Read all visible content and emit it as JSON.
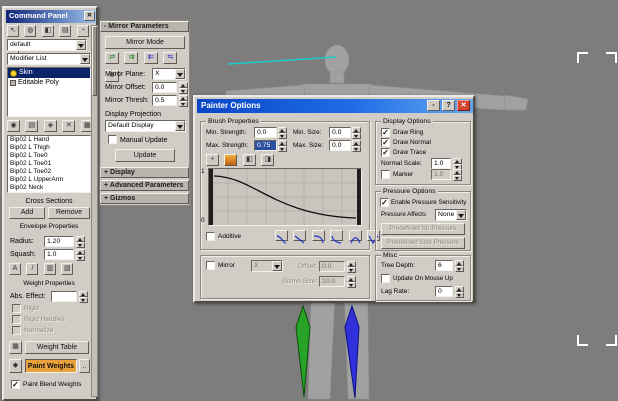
{
  "colors": {
    "viewport_bg": "#7d7d7d",
    "panel_bg": "#d1cdc6",
    "titlebar_gradient": [
      "#10277a",
      "#9cc1ec"
    ],
    "dialog_title_gradient": [
      "#0a46c6",
      "#63a7f0"
    ],
    "selection_blue": "#0a246a",
    "field_selected": "#2a50a0",
    "paint_weights_active": "#e9a13b",
    "bone_green": "#27a327",
    "bone_blue": "#3030dd",
    "crosssection_cyan": "#19cccc",
    "close_red": "#d6432f"
  },
  "icons": {
    "close": "✕",
    "help": "?",
    "minimize": "-",
    "collapse": "-",
    "expand": "+",
    "ellipsis": "..",
    "panel_tabs": [
      "↖",
      "◍",
      "◧",
      "▤",
      "◔",
      "▦"
    ],
    "stack_tools": [
      "◉",
      "▤",
      "◈",
      "✕",
      "▦"
    ],
    "envelope_tools": [
      "A",
      "/",
      "▥",
      "▧"
    ],
    "mirror_tools": [
      "⇄",
      "⇉",
      "⇇",
      "⇆",
      "⊕"
    ],
    "brush_tools": [
      "+",
      "▨",
      "◧",
      "◨"
    ],
    "weight_tool": "▦",
    "paint_tool": "◆"
  },
  "command_panel": {
    "title": "Command Panel",
    "object_name": "default",
    "modifier_list": "Modifier List",
    "stack": {
      "skin": "Skin",
      "editable_poly": "Editable Poly"
    },
    "bones": [
      "Bip02 L Hand",
      "Bip02 L Thigh",
      "Bip02 L Toe0",
      "Bip02 L Toe01",
      "Bip02 L Toe02",
      "Bip02 L UpperArm",
      "Bip02 Neck"
    ],
    "cross_sections": {
      "label": "Cross Sections",
      "add": "Add",
      "remove": "Remove"
    },
    "envelope": {
      "label": "Envelope Properties",
      "radius_label": "Radius:",
      "radius": "1.20",
      "squash_label": "Squash:",
      "squash": "1.0"
    },
    "weight": {
      "label": "Weight Properties",
      "abs_effect_label": "Abs. Effect:",
      "abs_effect": "",
      "rigid": "Rigid",
      "rigid_check": "",
      "rigid_handles": "Rigid Handles",
      "rigid_handles_check": "",
      "normalize": "Normalize",
      "normalize_check": ""
    },
    "weight_table": "Weight Table",
    "paint_weights": "Paint Weights",
    "paint_blend": "Paint Blend Weights",
    "paint_blend_check": "✓"
  },
  "mirror_rollout": {
    "header": "Mirror Parameters",
    "mirror_mode": "Mirror Mode",
    "plane_label": "Mirror Plane:",
    "plane": "X",
    "offset_label": "Mirror Offset:",
    "offset": "0.0",
    "thresh_label": "Mirror Thresh:",
    "thresh": "0.5",
    "display_projection": "Display Projection",
    "display_mode": "Default Display",
    "manual_update": "Manual Update",
    "manual_update_check": "",
    "update": "Update",
    "rollout_display": "Display",
    "rollout_advanced": "Advanced Parameters",
    "rollout_gizmos": "Gizmos"
  },
  "painter": {
    "title": "Painter Options",
    "brush": {
      "label": "Brush Properties",
      "min_strength_label": "Min. Strength:",
      "min_strength": "0.0",
      "max_strength_label": "Max. Strength:",
      "max_strength": "0.75",
      "min_size_label": "Min. Size:",
      "min_size": "0.0",
      "max_size_label": "Max. Size:",
      "max_size": "0.0",
      "curve_max": "1",
      "curve_min": "0",
      "additive": "Additive",
      "additive_check": ""
    },
    "mirror": {
      "label": "Mirror",
      "check": "",
      "axis": "X",
      "offset_label": "Offset:",
      "offset": "0.0",
      "gizmo_label": "Gizmo Size:",
      "gizmo": "10.0"
    },
    "display": {
      "label": "Display Options",
      "draw_ring": "Draw Ring",
      "draw_ring_check": "✓",
      "draw_normal": "Draw Normal",
      "draw_normal_check": "✓",
      "draw_trace": "Draw Trace",
      "draw_trace_check": "✓",
      "normal_scale_label": "Normal Scale:",
      "normal_scale": "1.0",
      "marker": "Marker",
      "marker_check": "",
      "marker_value": "1.0"
    },
    "pressure": {
      "label": "Pressure Options",
      "enable": "Enable Pressure Sensitivity",
      "enable_check": "✓",
      "affects_label": "Pressure Affects",
      "affects": "None",
      "predefined_str": "Predefined Str Pressure",
      "predefined_size": "Predefined Size Pressure"
    },
    "misc": {
      "label": "Misc",
      "tree_depth_label": "Tree Depth:",
      "tree_depth": "6",
      "update_mouse": "Update On Mouse Up",
      "update_mouse_check": "",
      "lag_label": "Lag Rate:",
      "lag": "0"
    }
  }
}
